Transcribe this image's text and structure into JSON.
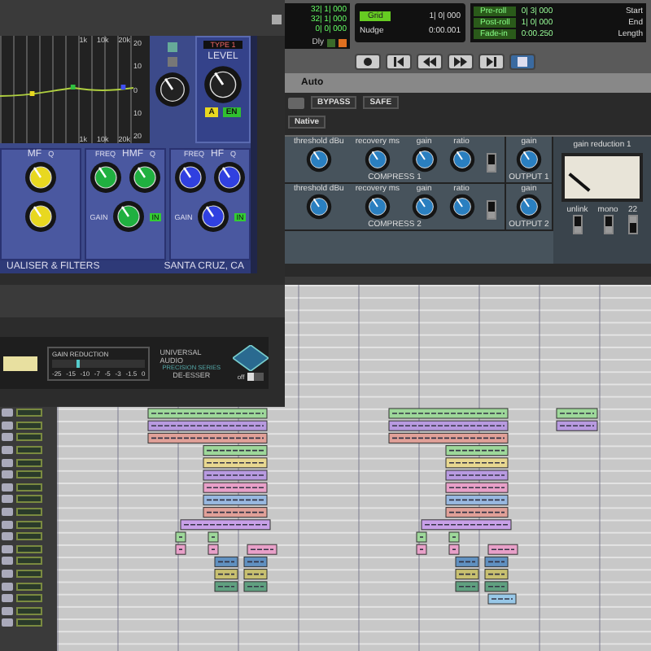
{
  "transport": {
    "counters": [
      "32| 1| 000",
      "32| 1| 000",
      "0| 0| 000"
    ],
    "dly_label": "Dly",
    "grid": {
      "label": "Grid",
      "value": "1| 0| 000"
    },
    "nudge": {
      "label": "Nudge",
      "value": "0:00.001"
    },
    "rolls": [
      {
        "label": "Pre-roll",
        "value": "0| 3| 000"
      },
      {
        "label": "Post-roll",
        "value": "1| 0| 000"
      },
      {
        "label": "Fade-in",
        "value": "0:00.250"
      }
    ],
    "selection_labels": [
      "Start",
      "End",
      "Length"
    ]
  },
  "compressor": {
    "auto_label": "Auto",
    "buttons": [
      "BYPASS",
      "SAFE",
      "Native"
    ],
    "rows": [
      {
        "labels": [
          "threshold dBu",
          "recovery ms",
          "gain",
          "ratio"
        ],
        "name": "COMPRESS 1",
        "switch_on": false,
        "output_label": "gain",
        "output_name": "OUTPUT 1"
      },
      {
        "labels": [
          "threshold dBu",
          "recovery ms",
          "gain",
          "ratio"
        ],
        "name": "COMPRESS 2",
        "switch_on": false,
        "output_label": "gain",
        "output_name": "OUTPUT 2"
      }
    ],
    "meter_label": "gain reduction 1",
    "switches": [
      {
        "label": "unlink",
        "on": false
      },
      {
        "label": "mono",
        "on": false
      },
      {
        "label": "22",
        "on": true
      }
    ]
  },
  "eq": {
    "freq_labels": [
      "1k",
      "10k",
      "20k"
    ],
    "db_labels": [
      "20",
      "10",
      "0",
      "10",
      "20"
    ],
    "freq_labels_bottom": [
      "1k",
      "10k",
      "20k"
    ],
    "type": "TYPE 1",
    "level_label": "LEVEL",
    "mode_buttons": [
      {
        "label": "A",
        "color": "#e8d820"
      },
      {
        "label": "EN",
        "color": "#30c030"
      }
    ],
    "bands": [
      {
        "name": "MF",
        "labels": [
          "Q"
        ],
        "color": "#e8d820"
      },
      {
        "name": "HMF",
        "labels": [
          "FREQ",
          "Q"
        ],
        "gain_label": "GAIN",
        "in_label": "IN",
        "color": "#20b040"
      },
      {
        "name": "HF",
        "labels": [
          "FREQ",
          "Q"
        ],
        "gain_label": "GAIN",
        "in_label": "IN",
        "color": "#3040e0"
      }
    ],
    "footer_left": "UALISER & FILTERS",
    "footer_right": "SANTA CRUZ, CA"
  },
  "deesser": {
    "meter_label": "GAIN REDUCTION",
    "level": 0.3,
    "scale": [
      "-25",
      "-15",
      "-10",
      "-7",
      "-5",
      "-3",
      "-1.5",
      "0"
    ],
    "brand": [
      "UNIVERSAL AUDIO",
      "PRECISION SERIES",
      "DE-ESSER"
    ],
    "switch_label": "off",
    "switch_on": false
  }
}
